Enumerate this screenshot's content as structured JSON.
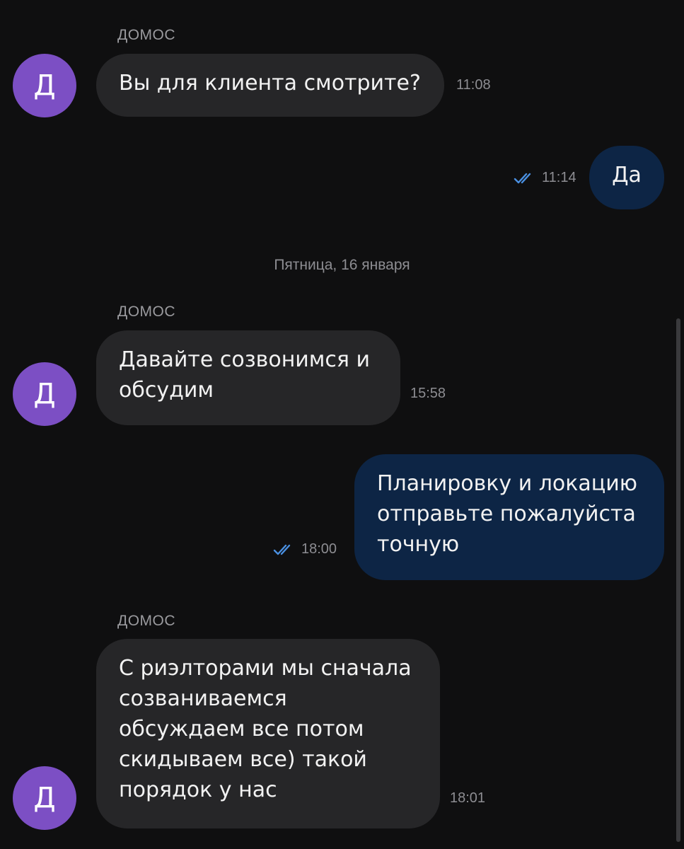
{
  "messages": [
    {
      "type": "incoming",
      "sender": "ДОМОС",
      "avatar_letter": "Д",
      "text": "Вы для клиента смотрите?",
      "time": "11:08"
    },
    {
      "type": "outgoing",
      "text": "Да",
      "time": "11:14",
      "status": "read"
    },
    {
      "type": "date",
      "text": "Пятница, 16 января"
    },
    {
      "type": "incoming",
      "sender": "ДОМОС",
      "avatar_letter": "Д",
      "text": "Давайте созвонимся и\nобсудим",
      "time": "15:58"
    },
    {
      "type": "outgoing",
      "text": "Планировку и локацию\nотправьте пожалуйста\nточную",
      "time": "18:00",
      "status": "read"
    },
    {
      "type": "incoming",
      "sender": "ДОМОС",
      "avatar_letter": "Д",
      "text": "С риэлторами мы сначала\nсозваниваемся\nобсуждаем все потом\nскидываем все) такой\nпорядок у нас",
      "time": "18:01"
    }
  ],
  "colors": {
    "background": "#0f0f10",
    "incoming_bubble": "#262628",
    "outgoing_bubble": "#0d2545",
    "avatar": "#7c4fc4",
    "read_check": "#4a90e2",
    "secondary_text": "#8d8d92"
  },
  "icons": {
    "read_status": "double-check-icon"
  }
}
